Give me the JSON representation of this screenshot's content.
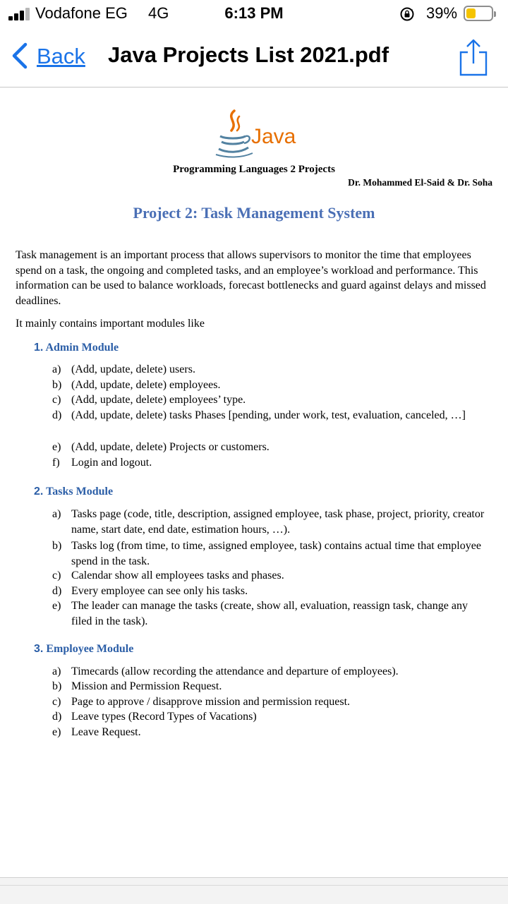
{
  "status": {
    "carrier": "Vodafone EG",
    "network": "4G",
    "time": "6:13 PM",
    "battery_percent": "39%",
    "battery_level": 0.39,
    "battery_color": "#f5c400"
  },
  "nav": {
    "back_label": "Back",
    "title": "Java Projects List 2021.pdf",
    "accent_color": "#1a73e8"
  },
  "document": {
    "logo_word": "Java",
    "course": "Programming Languages 2 Projects",
    "instructors": "Dr. Mohammed El-Said & Dr. Soha",
    "project_title": "Project 2: Task Management System",
    "intro": "Task management is an important process that allows supervisors to monitor the time that employees spend on a task, the ongoing and completed tasks, and an employee’s workload and performance. This information can be used to balance workloads, forecast bottlenecks and guard against delays and missed deadlines.",
    "intro2": "It mainly contains important modules like",
    "modules": [
      {
        "number": "1.",
        "title": "Admin Module",
        "items": [
          {
            "label": "a)",
            "text": "(Add, update, delete) users."
          },
          {
            "label": "b)",
            "text": "(Add, update, delete) employees."
          },
          {
            "label": "c)",
            "text": "(Add, update, delete) employees’ type."
          },
          {
            "label": "d)",
            "text": "(Add, update, delete) tasks Phases [pending, under work, test, evaluation, canceled, …]"
          },
          {
            "label": "e)",
            "text": "(Add, update, delete) Projects or customers."
          },
          {
            "label": "f)",
            "text": "Login and logout."
          }
        ]
      },
      {
        "number": "2.",
        "title": "Tasks Module",
        "items": [
          {
            "label": "a)",
            "text": "Tasks page (code, title, description, assigned employee, task phase, project, priority, creator name, start date, end date, estimation hours, …)."
          },
          {
            "label": "b)",
            "text": "Tasks log (from time, to time, assigned employee, task) contains actual time that employee spend in the task."
          },
          {
            "label": "c)",
            "text": "Calendar show all employees tasks and phases."
          },
          {
            "label": "d)",
            "text": "Every employee can see only his tasks."
          },
          {
            "label": "e)",
            "text": "The leader can manage the tasks (create, show all, evaluation, reassign task, change any filed in the task)."
          }
        ]
      },
      {
        "number": "3.",
        "title": "Employee Module",
        "items": [
          {
            "label": "a)",
            "text": "Timecards (allow recording the attendance and departure of employees)."
          },
          {
            "label": "b)",
            "text": "Mission and Permission Request."
          },
          {
            "label": "c)",
            "text": "Page to approve / disapprove mission and permission request."
          },
          {
            "label": "d)",
            "text": "Leave types (Record Types of Vacations)"
          },
          {
            "label": "e)",
            "text": "Leave Request."
          }
        ]
      }
    ]
  }
}
